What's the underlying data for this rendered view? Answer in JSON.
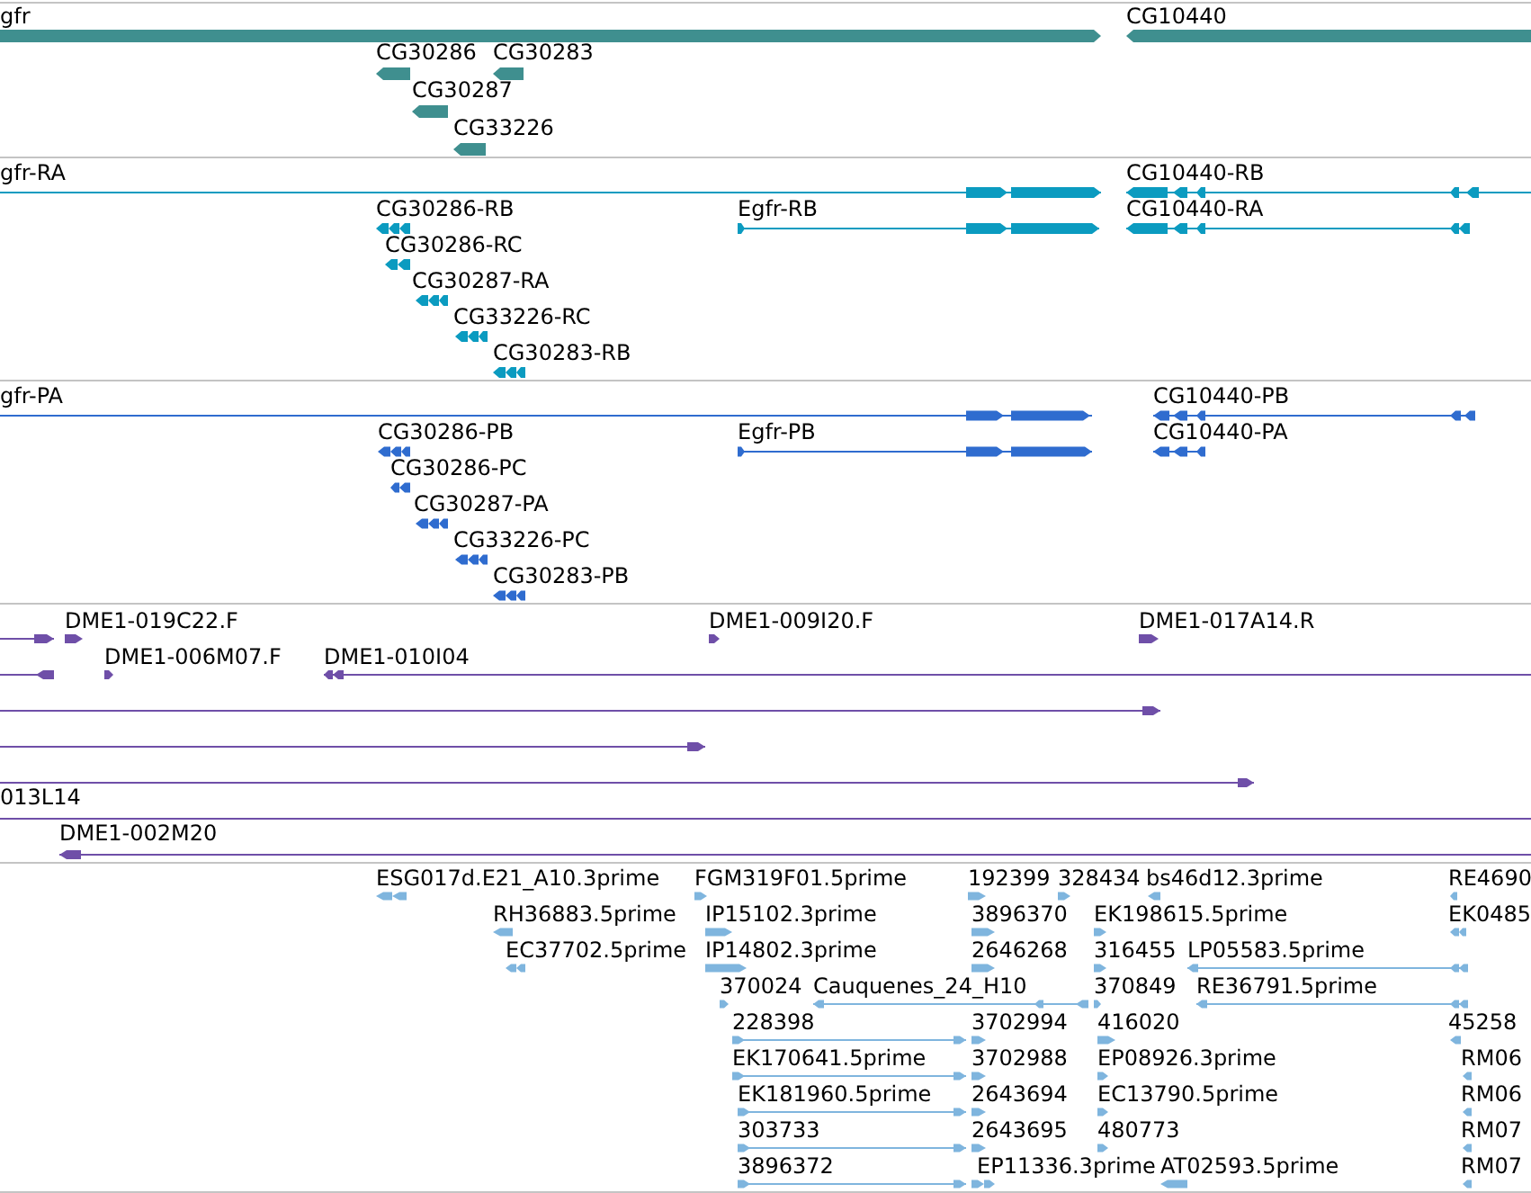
{
  "tracks": [
    {
      "kind": "gene",
      "color": "#3f8f8f",
      "features": [
        {
          "label": "gfr"
        },
        {
          "label": "CG10440"
        },
        {
          "label": "CG30286"
        },
        {
          "label": "CG30283"
        },
        {
          "label": "CG30287"
        },
        {
          "label": "CG33226"
        }
      ]
    },
    {
      "kind": "transcript",
      "color": "#0b9bc0",
      "features": [
        {
          "label": "gfr-RA"
        },
        {
          "label": "CG10440-RB"
        },
        {
          "label": "CG30286-RB"
        },
        {
          "label": "Egfr-RB"
        },
        {
          "label": "CG10440-RA"
        },
        {
          "label": "CG30286-RC"
        },
        {
          "label": "CG30287-RA"
        },
        {
          "label": "CG33226-RC"
        },
        {
          "label": "CG30283-RB"
        }
      ]
    },
    {
      "kind": "protein",
      "color": "#2f6ccf",
      "features": [
        {
          "label": "gfr-PA"
        },
        {
          "label": "CG10440-PB"
        },
        {
          "label": "CG30286-PB"
        },
        {
          "label": "Egfr-PB"
        },
        {
          "label": "CG10440-PA"
        },
        {
          "label": "CG30286-PC"
        },
        {
          "label": "CG30287-PA"
        },
        {
          "label": "CG33226-PC"
        },
        {
          "label": "CG30283-PB"
        }
      ]
    },
    {
      "kind": "clone",
      "color": "#6f4fa8",
      "features": [
        {
          "label": "DME1-019C22.F"
        },
        {
          "label": "DME1-009I20.F"
        },
        {
          "label": "DME1-017A14.R"
        },
        {
          "label": "DME1-006M07.F"
        },
        {
          "label": "DME1-010I04"
        },
        {
          "label": "013L14"
        },
        {
          "label": "DME1-002M20"
        }
      ]
    },
    {
      "kind": "est",
      "color": "#7fb5de",
      "features": [
        {
          "label": "ESG017d.E21_A10.3prime"
        },
        {
          "label": "FGM319F01.5prime"
        },
        {
          "label": "192399"
        },
        {
          "label": "328434"
        },
        {
          "label": "bs46d12.3prime"
        },
        {
          "label": "RE4690"
        },
        {
          "label": "RH36883.5prime"
        },
        {
          "label": "IP15102.3prime"
        },
        {
          "label": "3896370"
        },
        {
          "label": "EK198615.5prime"
        },
        {
          "label": "EK0485"
        },
        {
          "label": "EC37702.5prime"
        },
        {
          "label": "IP14802.3prime"
        },
        {
          "label": "2646268"
        },
        {
          "label": "316455"
        },
        {
          "label": "LP05583.5prime"
        },
        {
          "label": "370024"
        },
        {
          "label": "Cauquenes_24_H10"
        },
        {
          "label": "370849"
        },
        {
          "label": "RE36791.5prime"
        },
        {
          "label": "228398"
        },
        {
          "label": "3702994"
        },
        {
          "label": "416020"
        },
        {
          "label": "45258"
        },
        {
          "label": "EK170641.5prime"
        },
        {
          "label": "3702988"
        },
        {
          "label": "EP08926.3prime"
        },
        {
          "label": "RM06"
        },
        {
          "label": "EK181960.5prime"
        },
        {
          "label": "2643694"
        },
        {
          "label": "EC13790.5prime"
        },
        {
          "label": "RM06"
        },
        {
          "label": "303733"
        },
        {
          "label": "2643695"
        },
        {
          "label": "480773"
        },
        {
          "label": "RM07"
        },
        {
          "label": "3896372"
        },
        {
          "label": "EP11336.3prime"
        },
        {
          "label": "AT02593.5prime"
        },
        {
          "label": "RM07"
        }
      ]
    }
  ]
}
